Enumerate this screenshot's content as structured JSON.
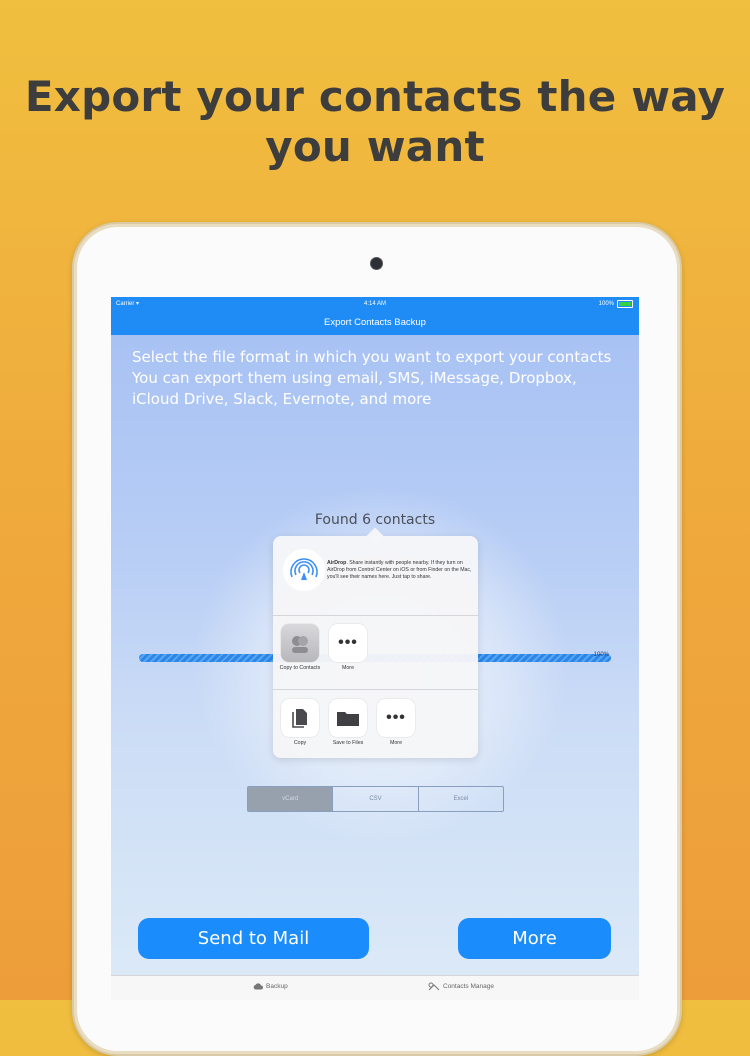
{
  "headline": {
    "line1": "Export your contacts the way",
    "line2": "you want"
  },
  "status_bar": {
    "carrier": "Carrier",
    "time": "4:14 AM",
    "battery": "100%"
  },
  "nav": {
    "title": "Export Contacts Backup"
  },
  "intro": {
    "line1": "Select the file format in which you want to export your contacts",
    "line2": "You can export them using email, SMS, iMessage, Dropbox,",
    "line3": "iCloud Drive, Slack, Evernote, and more"
  },
  "found": "Found 6 contacts",
  "progress": {
    "label": "100%",
    "value": 100
  },
  "share_sheet": {
    "airdrop": {
      "title": "AirDrop",
      "text": "Share instantly with people nearby. If they turn on AirDrop from Control Center on iOS or from Finder on the Mac, you'll see their names here. Just tap to share."
    },
    "apps": [
      {
        "label": "Copy to Contacts",
        "icon": "contacts-app-icon"
      },
      {
        "label": "More",
        "icon": "more-dots-icon"
      }
    ],
    "actions": [
      {
        "label": "Copy",
        "icon": "copy-doc-icon"
      },
      {
        "label": "Save to Files",
        "icon": "folder-icon"
      },
      {
        "label": "More",
        "icon": "more-dots-icon"
      }
    ]
  },
  "formats": [
    "vCard",
    "CSV",
    "Excel"
  ],
  "buttons": {
    "send_mail": "Send to Mail",
    "more": "More"
  },
  "tabs": {
    "backup": "Backup",
    "manage": "Contacts Manage"
  },
  "colors": {
    "accent": "#1b8cfb",
    "background": "#f0b33d",
    "headline": "#3d3d3d"
  }
}
